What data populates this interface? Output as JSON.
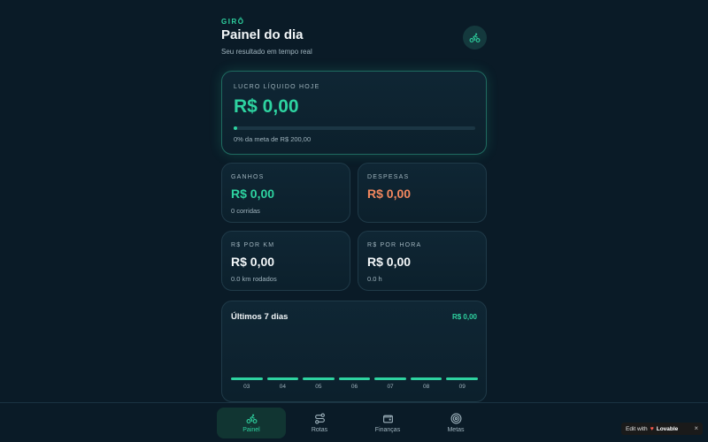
{
  "header": {
    "brand": "GIRÔ",
    "title": "Painel do dia",
    "subtitle": "Seu resultado em tempo real",
    "action_icon": "bike-icon"
  },
  "hero": {
    "label": "LUCRO LÍQUIDO HOJE",
    "value": "R$ 0,00",
    "progress_percent": 0,
    "goal_text": "0% da meta de R$ 200,00"
  },
  "cards": {
    "ganhos": {
      "label": "GANHOS",
      "value": "R$ 0,00",
      "sub": "0 corridas"
    },
    "despesas": {
      "label": "DESPESAS",
      "value": "R$ 0,00"
    },
    "por_km": {
      "label": "R$ POR KM",
      "value": "R$ 0,00",
      "sub": "0.0 km rodados"
    },
    "por_hora": {
      "label": "R$ POR HORA",
      "value": "R$ 0,00",
      "sub": "0.0 h"
    }
  },
  "chart": {
    "title": "Últimos 7 dias",
    "total": "R$ 0,00"
  },
  "chart_data": {
    "type": "bar",
    "categories": [
      "03",
      "04",
      "05",
      "06",
      "07",
      "08",
      "09"
    ],
    "values": [
      0,
      0,
      0,
      0,
      0,
      0,
      0
    ],
    "title": "Últimos 7 dias",
    "xlabel": "",
    "ylabel": "",
    "grid": false
  },
  "nav": {
    "items": [
      {
        "label": "Painel",
        "icon": "bike-icon",
        "active": true
      },
      {
        "label": "Rotas",
        "icon": "route-icon",
        "active": false
      },
      {
        "label": "Finanças",
        "icon": "wallet-icon",
        "active": false
      },
      {
        "label": "Metas",
        "icon": "target-icon",
        "active": false
      }
    ]
  },
  "badge": {
    "prefix": "Edit with",
    "brand": "Lovable",
    "close": "×"
  },
  "colors": {
    "background": "#0a1b27",
    "accent": "#2ed3a0",
    "expense": "#f2875e"
  }
}
